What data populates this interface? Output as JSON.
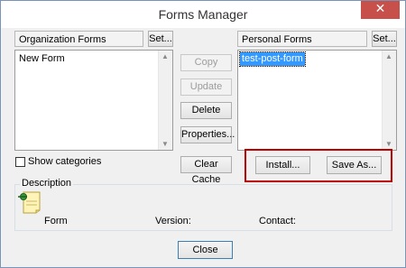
{
  "window": {
    "title": "Forms Manager",
    "close_glyph": "✕"
  },
  "left_panel": {
    "label": "Organization Forms",
    "set_button": "Set...",
    "items": [
      "New Form"
    ]
  },
  "middle_buttons": {
    "copy": "Copy",
    "update": "Update",
    "delete": "Delete",
    "properties": "Properties...",
    "clear_cache": "Clear Cache"
  },
  "right_panel": {
    "label": "Personal Forms",
    "set_button": "Set...",
    "items": [
      "test-post-form"
    ]
  },
  "show_categories": "Show categories",
  "install_button": "Install...",
  "save_as_button": "Save As...",
  "description": {
    "legend": "Description",
    "form_label": "Form",
    "version_label": "Version:",
    "contact_label": "Contact:"
  },
  "footer": {
    "close_button": "Close"
  },
  "colors": {
    "highlight": "#c00000",
    "selection": "#3399ff",
    "close_red": "#c7504a"
  }
}
